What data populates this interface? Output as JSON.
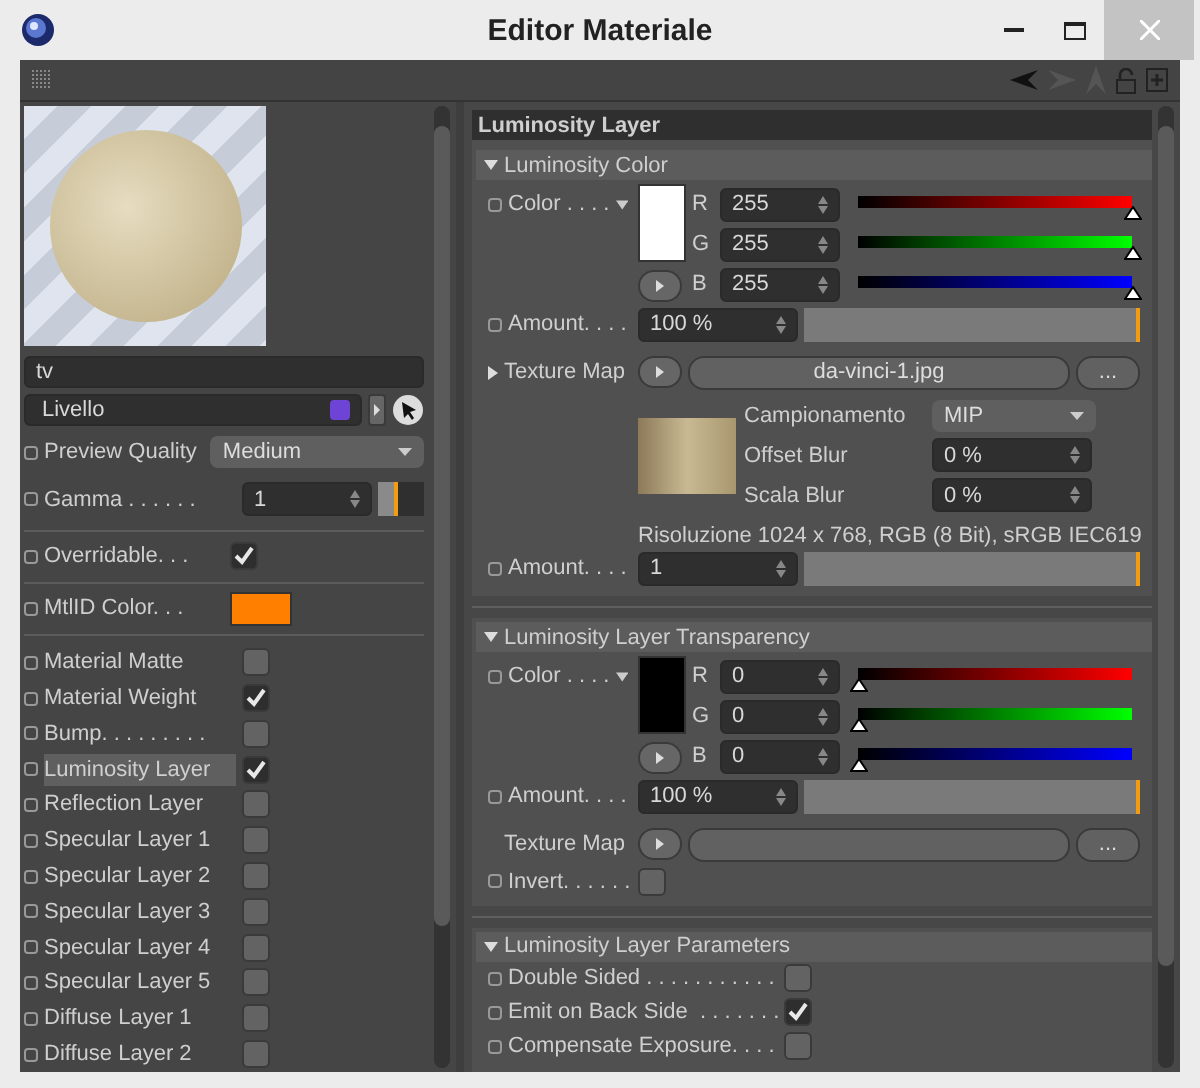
{
  "window": {
    "title": "Editor Materiale"
  },
  "material": {
    "name": "tv",
    "layer": "Livello",
    "preview_quality": {
      "label": "Preview Quality",
      "value": "Medium"
    },
    "gamma": {
      "label": "Gamma . . . . . .",
      "value": "1",
      "level": 0.45
    },
    "overridable": {
      "label": "Overridable. . .",
      "checked": true
    },
    "mtlid_color": {
      "label": "MtlID Color. . .",
      "color": "#ff8000"
    }
  },
  "channels": [
    {
      "label": "Material Matte",
      "checked": false,
      "selected": false
    },
    {
      "label": "Material Weight",
      "checked": true,
      "selected": false
    },
    {
      "label": "Bump. . . . . . . . .",
      "checked": false,
      "selected": false
    },
    {
      "label": "Luminosity Layer",
      "checked": true,
      "selected": true
    },
    {
      "label": "Reflection Layer",
      "checked": false,
      "selected": false
    },
    {
      "label": "Specular Layer 1",
      "checked": false,
      "selected": false
    },
    {
      "label": "Specular Layer 2",
      "checked": false,
      "selected": false
    },
    {
      "label": "Specular Layer 3",
      "checked": false,
      "selected": false
    },
    {
      "label": "Specular Layer 4",
      "checked": false,
      "selected": false
    },
    {
      "label": "Specular Layer 5",
      "checked": false,
      "selected": false
    },
    {
      "label": "Diffuse Layer 1",
      "checked": false,
      "selected": false
    },
    {
      "label": "Diffuse Layer 2",
      "checked": false,
      "selected": false
    }
  ],
  "panel": {
    "title": "Luminosity Layer",
    "luminosity_color": {
      "title": "Luminosity Color",
      "expanded": true,
      "color": {
        "label": "Color . . . .",
        "channels": [
          {
            "kind": "red",
            "name": "R",
            "value": "255",
            "level": 1
          },
          {
            "kind": "green",
            "name": "G",
            "value": "255",
            "level": 1
          },
          {
            "kind": "blue",
            "name": "B",
            "value": "255",
            "level": 1
          }
        ]
      },
      "amount": {
        "label": "Amount. . . .",
        "value": "100 %",
        "level": 1
      },
      "texture_map": {
        "label": "Texture Map",
        "expanded": false,
        "file": "da-vinci-1.jpg",
        "browse": "...",
        "sampling": {
          "label": "Campionamento",
          "value": "MIP"
        },
        "offset_blur": {
          "label": "Offset Blur",
          "value": "0 %"
        },
        "scale_blur": {
          "label": "Scala Blur",
          "value": "0 %"
        },
        "resolution": "Risoluzione 1024 x 768, RGB (8 Bit), sRGB IEC619"
      },
      "texture_amount": {
        "label": "Amount. . . .",
        "value": "1",
        "level": 1
      }
    },
    "transparency": {
      "title": "Luminosity Layer Transparency",
      "expanded": true,
      "color": {
        "label": "Color . . . .",
        "channels": [
          {
            "kind": "red",
            "name": "R",
            "value": "0",
            "level": 0
          },
          {
            "kind": "green",
            "name": "G",
            "value": "0",
            "level": 0
          },
          {
            "kind": "blue",
            "name": "B",
            "value": "0",
            "level": 0
          }
        ]
      },
      "amount": {
        "label": "Amount. . . .",
        "value": "100 %",
        "level": 1
      },
      "texture_map": {
        "label": "Texture Map",
        "browse": "..."
      },
      "invert": {
        "label": "Invert. . . . . .",
        "checked": false
      }
    },
    "parameters": {
      "title": "Luminosity Layer Parameters",
      "expanded": true,
      "items": [
        {
          "label": "Double Sided . . . . . . . . . . .",
          "checked": false
        },
        {
          "label": "Emit on Back Side  . . . . . . .",
          "checked": true
        },
        {
          "label": "Compensate Exposure. . . .",
          "checked": false
        }
      ]
    }
  }
}
